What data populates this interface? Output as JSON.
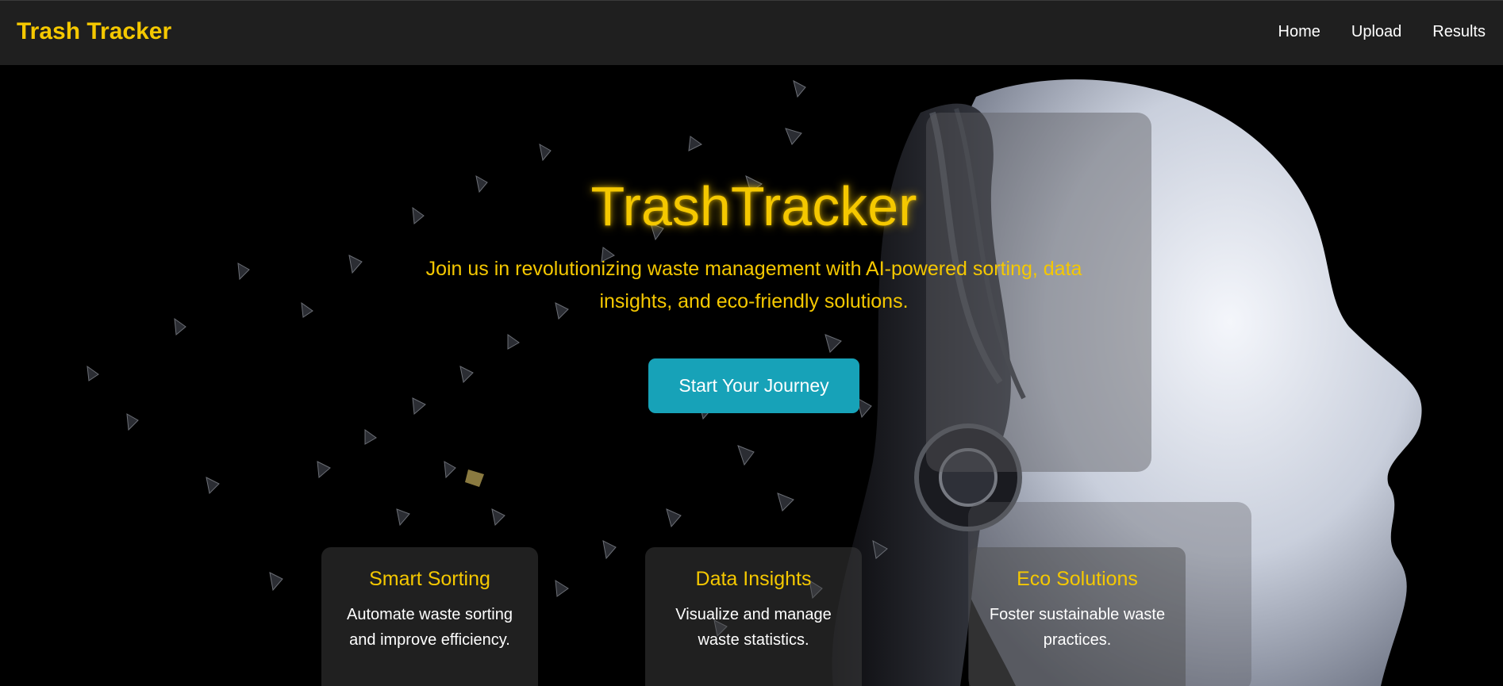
{
  "nav": {
    "brand": "Trash Tracker",
    "links": [
      "Home",
      "Upload",
      "Results"
    ]
  },
  "hero": {
    "title": "TrashTracker",
    "subtitle": "Join us in revolutionizing waste management with AI-powered sorting, data insights, and eco-friendly solutions.",
    "cta_label": "Start Your Journey"
  },
  "features": [
    {
      "title": "Smart Sorting",
      "text": "Automate waste sorting and improve efficiency."
    },
    {
      "title": "Data Insights",
      "text": "Visualize and manage waste statistics."
    },
    {
      "title": "Eco Solutions",
      "text": "Foster sustainable waste practices."
    }
  ],
  "colors": {
    "accent": "#f5c800",
    "button": "#17a2b8",
    "navbar": "#1f1f1f",
    "background": "#000000"
  }
}
